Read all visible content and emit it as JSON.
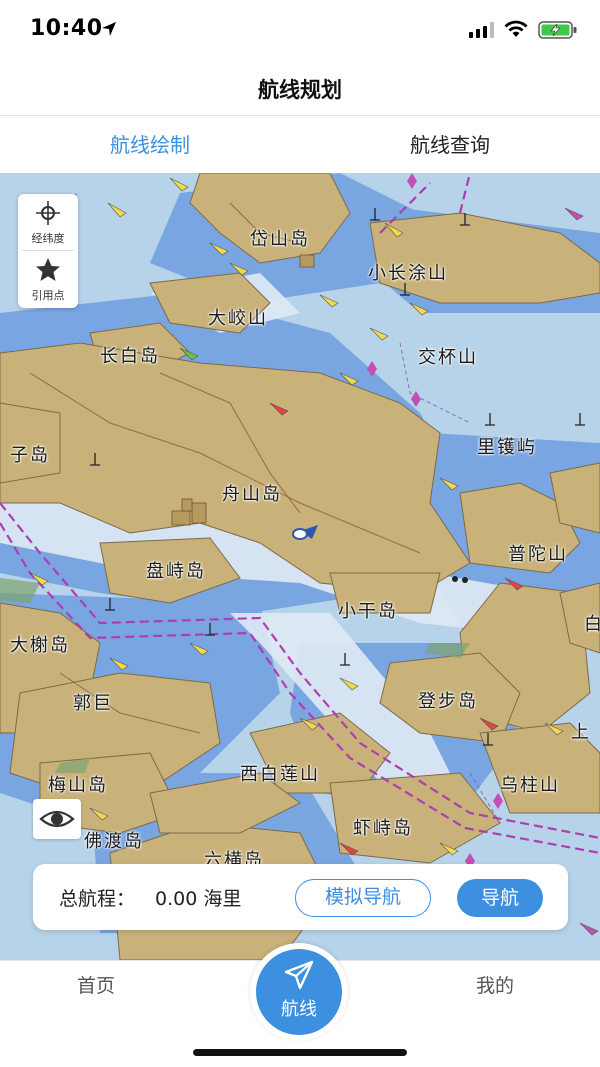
{
  "status_bar": {
    "time": "10:40"
  },
  "nav": {
    "title": "航线规划"
  },
  "tabs": [
    {
      "label": "航线绘制",
      "active": true
    },
    {
      "label": "航线查询",
      "active": false
    }
  ],
  "map": {
    "tools": [
      {
        "label": "经纬度",
        "icon": "crosshair-icon"
      },
      {
        "label": "引用点",
        "icon": "star-icon"
      }
    ],
    "places": [
      "岱山岛",
      "小长涂山",
      "大峧山",
      "长白岛",
      "交杯山",
      "子岛",
      "里镬屿",
      "舟山岛",
      "普陀山",
      "盘峙岛",
      "小干岛",
      "大榭岛",
      "郭巨",
      "登步岛",
      "上",
      "西白莲山",
      "乌柱山",
      "梅山岛",
      "虾峙岛",
      "佛渡岛",
      "六横岛",
      "白"
    ]
  },
  "route": {
    "total_label": "总航程：",
    "total_value": "0.00 海里",
    "simulate_label": "模拟导航",
    "navigate_label": "导航"
  },
  "tabbar": {
    "home": "首页",
    "route": "航线",
    "mine": "我的"
  },
  "colors": {
    "accent": "#3d8fe0",
    "sea": "#b7d3ea",
    "shallow": "#6f9ee0",
    "land": "#c9b27a",
    "route_line": "#b03cb0"
  }
}
